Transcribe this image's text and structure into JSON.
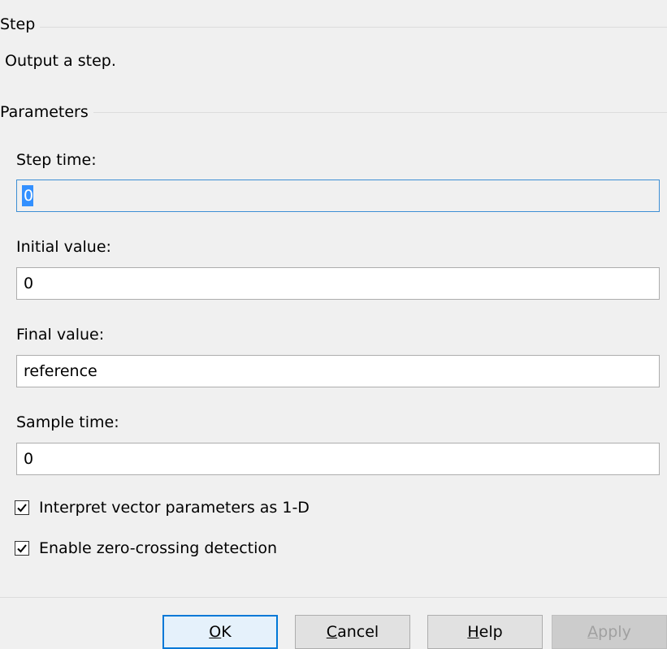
{
  "block": {
    "group_title": "Step",
    "description": "Output a step."
  },
  "parameters": {
    "group_title": "Parameters",
    "step_time": {
      "label": "Step time:",
      "value": "0"
    },
    "initial_value": {
      "label": "Initial value:",
      "value": "0"
    },
    "final_value": {
      "label": "Final value:",
      "value": "reference"
    },
    "sample_time": {
      "label": "Sample time:",
      "value": "0"
    }
  },
  "options": {
    "interpret_vector": {
      "label": "Interpret vector parameters as 1-D",
      "checked": true
    },
    "zero_crossing": {
      "label": "Enable zero-crossing detection",
      "checked": true
    }
  },
  "buttons": {
    "ok": {
      "mnemonic": "O",
      "rest": "K"
    },
    "cancel": {
      "mnemonic": "C",
      "rest": "ancel"
    },
    "help": {
      "mnemonic": "H",
      "rest": "elp"
    },
    "apply": {
      "mnemonic": "A",
      "rest": "pply"
    }
  },
  "icons": {
    "checkbox_checked": "check-icon"
  },
  "colors": {
    "background": "#f0f0f0",
    "focus_border": "#3d8fd4",
    "selection": "#3390ff",
    "default_button_border": "#0078d7",
    "disabled_text": "#a0a0a0"
  }
}
